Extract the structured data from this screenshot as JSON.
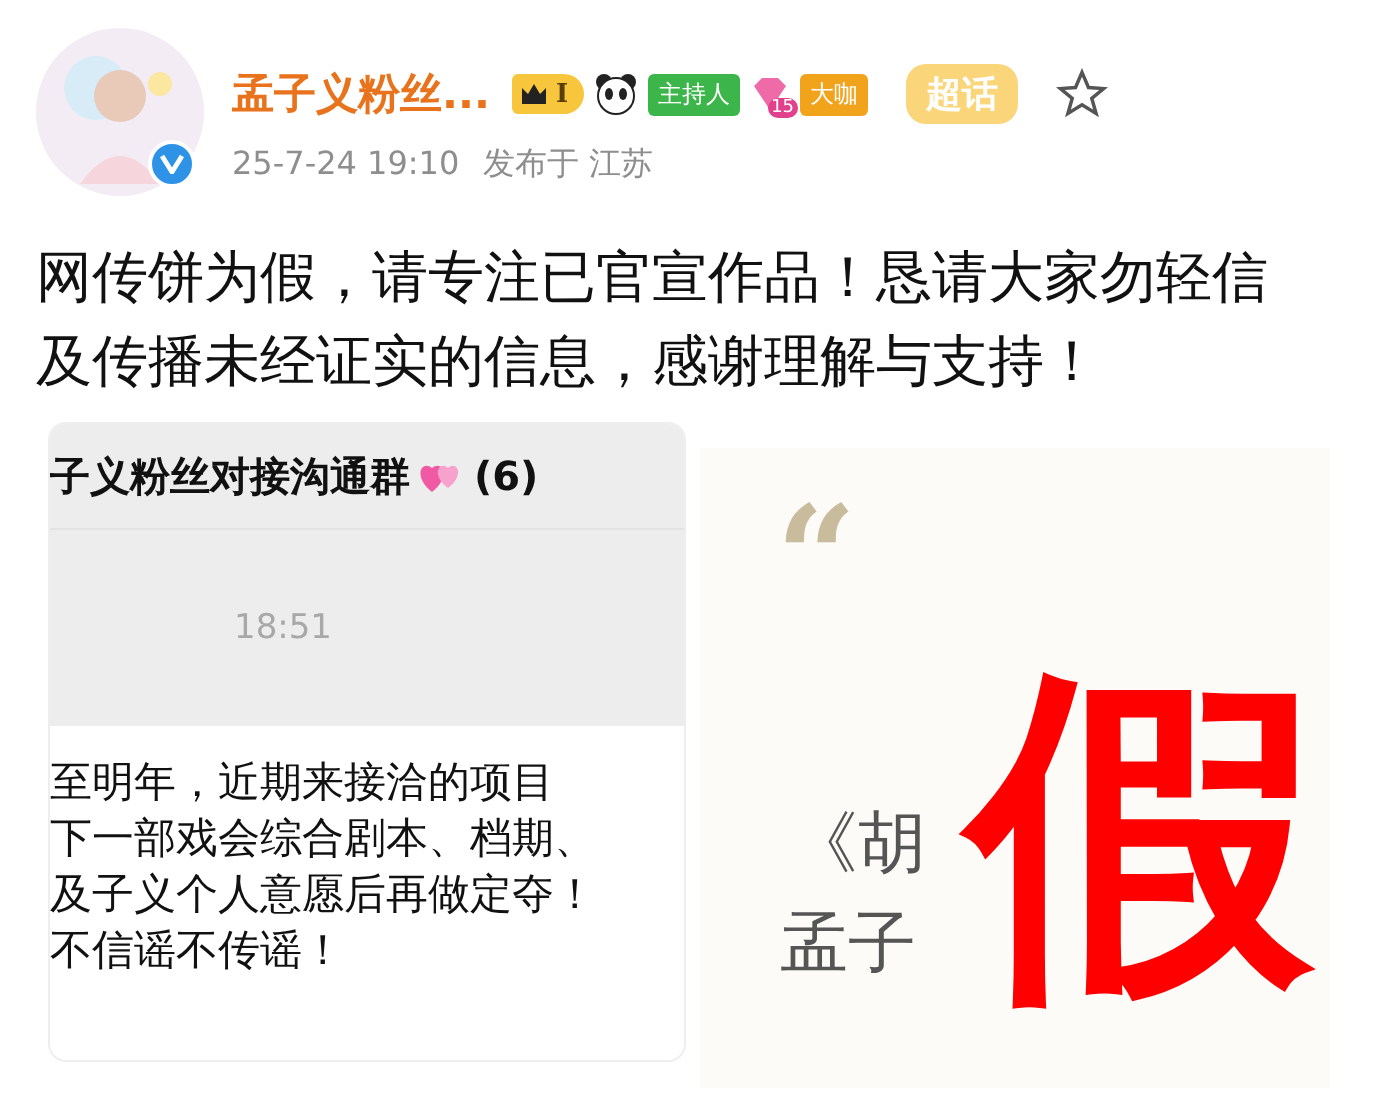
{
  "post": {
    "author": "孟子义粉丝...",
    "verified": true,
    "badges": [
      {
        "kind": "crown",
        "text": "I"
      },
      {
        "kind": "panda"
      },
      {
        "kind": "tag",
        "text": "主持人",
        "color": "#3cb64a"
      },
      {
        "kind": "gem",
        "text": "15"
      },
      {
        "kind": "tag",
        "text": "大咖",
        "color": "#f2a31c"
      },
      {
        "kind": "topic",
        "text": "超话"
      }
    ],
    "starred": false,
    "time": "25-7-24 19:10",
    "location": "发布于 江苏",
    "body": "网传饼为假，请专注已官宣作品！恳请大家勿轻信及传播未经证实的信息，感谢理解与支持！"
  },
  "images": [
    {
      "kind": "chat",
      "group": "子义粉丝对接沟通群",
      "count": "(6)",
      "time": "18:51",
      "lines": [
        "至明年，近期来接洽的项目",
        "下一部戏会综合剧本、档期、",
        "及子义个人意愿后再做定夺！",
        "不信谣不传谣！"
      ]
    },
    {
      "kind": "quote",
      "mark": "“",
      "title": "《胡",
      "line": "孟子",
      "stamp": "假"
    }
  ]
}
